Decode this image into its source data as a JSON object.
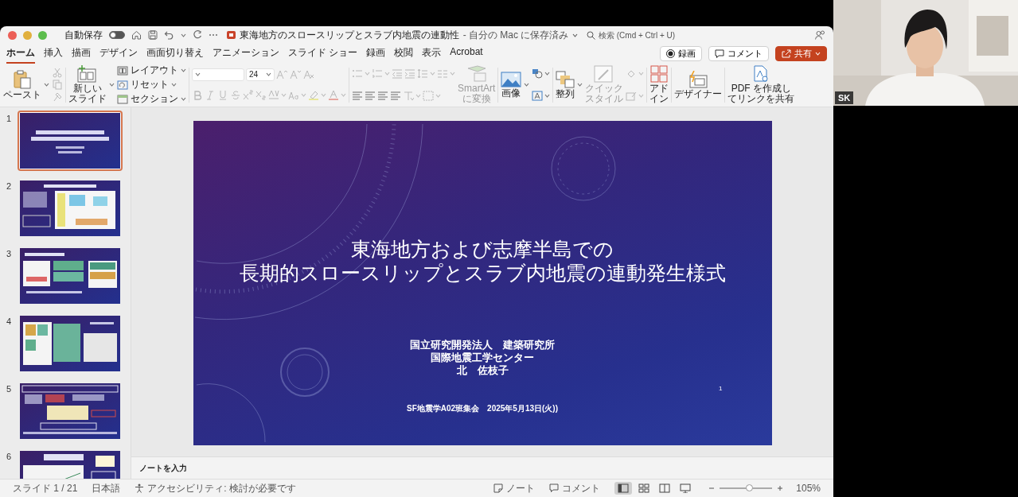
{
  "window": {
    "autosave_label": "自動保存",
    "autosave_on": false,
    "title": "東海地方のスロースリップとスラブ内地震の連動性",
    "save_status": "- 自分の Mac に保存済み",
    "search_placeholder": "検索 (Cmd + Ctrl + U)"
  },
  "tabs": [
    {
      "label": "ホーム",
      "selected": true
    },
    {
      "label": "挿入",
      "selected": false
    },
    {
      "label": "描画",
      "selected": false
    },
    {
      "label": "デザイン",
      "selected": false
    },
    {
      "label": "画面切り替え",
      "selected": false
    },
    {
      "label": "アニメーション",
      "selected": false
    },
    {
      "label": "スライド ショー",
      "selected": false
    },
    {
      "label": "録画",
      "selected": false
    },
    {
      "label": "校閲",
      "selected": false
    },
    {
      "label": "表示",
      "selected": false
    },
    {
      "label": "Acrobat",
      "selected": false
    }
  ],
  "tab_actions": [
    {
      "kind": "record",
      "label": "録画"
    },
    {
      "kind": "comment",
      "label": "コメント"
    },
    {
      "kind": "share",
      "label": "共有"
    }
  ],
  "ribbon": {
    "paste": "ペースト",
    "new_slide": [
      "新しい",
      "スライド"
    ],
    "slide_commands": [
      "レイアウト",
      "リセット",
      "セクション"
    ],
    "font_size": "24",
    "smartart": {
      "lines": [
        "SmartArt",
        "に変換"
      ],
      "disabled": true
    },
    "image": "画像",
    "arrange": "整列",
    "quick_style": {
      "lines": [
        "クイック",
        "スタイル"
      ],
      "disabled": true
    },
    "addins": [
      "アド",
      "イン"
    ],
    "designer": "デザイナー",
    "pdf": [
      "PDF を作成し",
      "てリンクを共有"
    ]
  },
  "thumbnails": [
    {
      "number": "1",
      "selected": true
    },
    {
      "number": "2",
      "selected": false
    },
    {
      "number": "3",
      "selected": false
    },
    {
      "number": "4",
      "selected": false
    },
    {
      "number": "5",
      "selected": false
    },
    {
      "number": "6",
      "selected": false
    }
  ],
  "slide": {
    "title_lines": [
      "東海地方および志摩半島での",
      "長期的スロースリップとスラブ内地震の連動発生様式"
    ],
    "subtitle_lines": [
      "国立研究開発法人　建築研究所",
      "国際地震工学センター",
      "北　佐枝子"
    ],
    "page_number": "1",
    "footer": "SF地震学A02班集会　2025年5月13日(火))"
  },
  "notes": {
    "placeholder": "ノートを入力"
  },
  "status_bar": {
    "slide_position": "スライド 1 / 21",
    "language": "日本語",
    "accessibility": "アクセシビリティ: 検討が必要です",
    "notes_button": "ノート",
    "comments_button": "コメント",
    "views": [
      {
        "kind": "normal",
        "selected": true
      },
      {
        "kind": "sorter",
        "selected": false
      },
      {
        "kind": "reading",
        "selected": false
      },
      {
        "kind": "slideshow",
        "selected": false
      }
    ],
    "zoom": {
      "level": 0.55,
      "reading": "105%"
    }
  },
  "webcam": {
    "initials": "SK"
  }
}
